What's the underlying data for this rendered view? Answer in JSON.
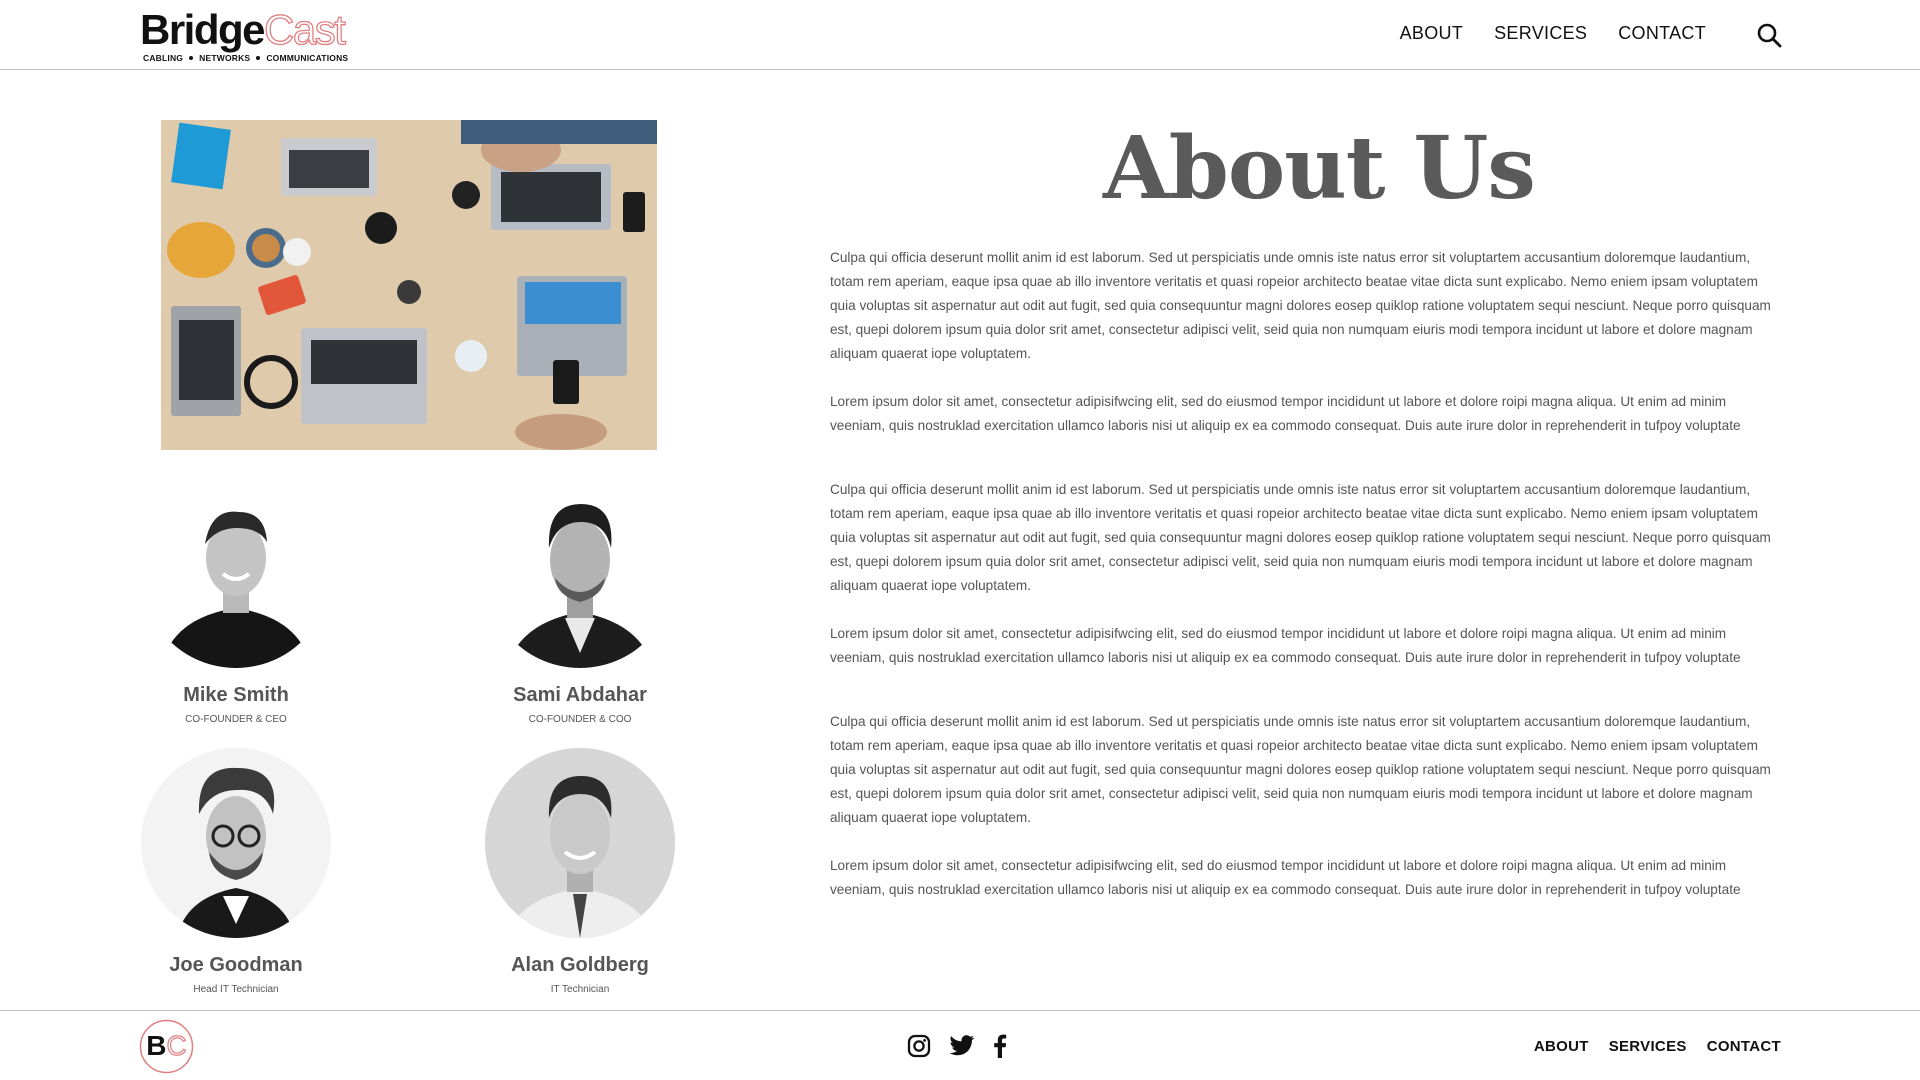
{
  "brand": {
    "name_part1": "Bridge",
    "name_part2": "Cast",
    "tagline": [
      "CABLING",
      "NETWORKS",
      "COMMUNICATIONS"
    ],
    "monogram": "BC",
    "accent_color": "#e07f82"
  },
  "nav": {
    "items": [
      "ABOUT",
      "SERVICES",
      "CONTACT"
    ],
    "search_icon": "search-icon"
  },
  "hero": {
    "icon": "photo-office-desk"
  },
  "team": [
    {
      "name": "Mike Smith",
      "role": "CO-FOUNDER & CEO"
    },
    {
      "name": "Sami Abdahar",
      "role": "CO-FOUNDER & COO"
    },
    {
      "name": "Joe Goodman",
      "role": "Head IT Technician"
    },
    {
      "name": "Alan Goldberg",
      "role": "IT Technician"
    }
  ],
  "about": {
    "title": "About Us",
    "sections": [
      {
        "long": "Culpa qui officia deserunt mollit anim id est laborum. Sed ut perspiciatis unde omnis iste natus error sit voluptartem accusantium doloremque laudantium, totam rem aperiam, eaque ipsa quae ab illo inventore veritatis et quasi ropeior architecto beatae vitae dicta sunt explicabo. Nemo eniem ipsam voluptatem quia voluptas sit aspernatur aut odit aut fugit, sed quia consequuntur magni dolores eosep quiklop ratione voluptatem sequi nesciunt. Neque porro quisquam est, quepi dolorem ipsum quia dolor srit amet, consectetur adipisci velit, seid quia non numquam eiuris modi tempora incidunt ut labore et dolore magnam aliquam quaerat iope voluptatem.",
        "short": "Lorem ipsum dolor sit amet, consectetur adipisifwcing elit, sed do eiusmod tempor incididunt ut labore et dolore roipi magna aliqua. Ut enim ad minim veeniam, quis nostruklad exercitation ullamco laboris nisi ut aliquip ex ea commodo consequat. Duis aute irure dolor in reprehenderit in tufpoy voluptate"
      },
      {
        "long": "Culpa qui officia deserunt mollit anim id est laborum. Sed ut perspiciatis unde omnis iste natus error sit voluptartem accusantium doloremque laudantium, totam rem aperiam, eaque ipsa quae ab illo inventore veritatis et quasi ropeior architecto beatae vitae dicta sunt explicabo. Nemo eniem ipsam voluptatem quia voluptas sit aspernatur aut odit aut fugit, sed quia consequuntur magni dolores eosep quiklop ratione voluptatem sequi nesciunt. Neque porro quisquam est, quepi dolorem ipsum quia dolor srit amet, consectetur adipisci velit, seid quia non numquam eiuris modi tempora incidunt ut labore et dolore magnam aliquam quaerat iope voluptatem.",
        "short": "Lorem ipsum dolor sit amet, consectetur adipisifwcing elit, sed do eiusmod tempor incididunt ut labore et dolore roipi magna aliqua. Ut enim ad minim veeniam, quis nostruklad exercitation ullamco laboris nisi ut aliquip ex ea commodo consequat. Duis aute irure dolor in reprehenderit in tufpoy voluptate"
      },
      {
        "long": "Culpa qui officia deserunt mollit anim id est laborum. Sed ut perspiciatis unde omnis iste natus error sit voluptartem accusantium doloremque laudantium, totam rem aperiam, eaque ipsa quae ab illo inventore veritatis et quasi ropeior architecto beatae vitae dicta sunt explicabo. Nemo eniem ipsam voluptatem quia voluptas sit aspernatur aut odit aut fugit, sed quia consequuntur magni dolores eosep quiklop ratione voluptatem sequi nesciunt. Neque porro quisquam est, quepi dolorem ipsum quia dolor srit amet, consectetur adipisci velit, seid quia non numquam eiuris modi tempora incidunt ut labore et dolore magnam aliquam quaerat iope voluptatem.",
        "short": "Lorem ipsum dolor sit amet, consectetur adipisifwcing elit, sed do eiusmod tempor incididunt ut labore et dolore roipi magna aliqua. Ut enim ad minim veeniam, quis nostruklad exercitation ullamco laboris nisi ut aliquip ex ea commodo consequat. Duis aute irure dolor in reprehenderit in tufpoy voluptate"
      }
    ]
  },
  "footer": {
    "social_icons": [
      "instagram-icon",
      "twitter-icon",
      "facebook-icon"
    ],
    "nav": [
      "ABOUT",
      "SERVICES",
      "CONTACT"
    ]
  }
}
